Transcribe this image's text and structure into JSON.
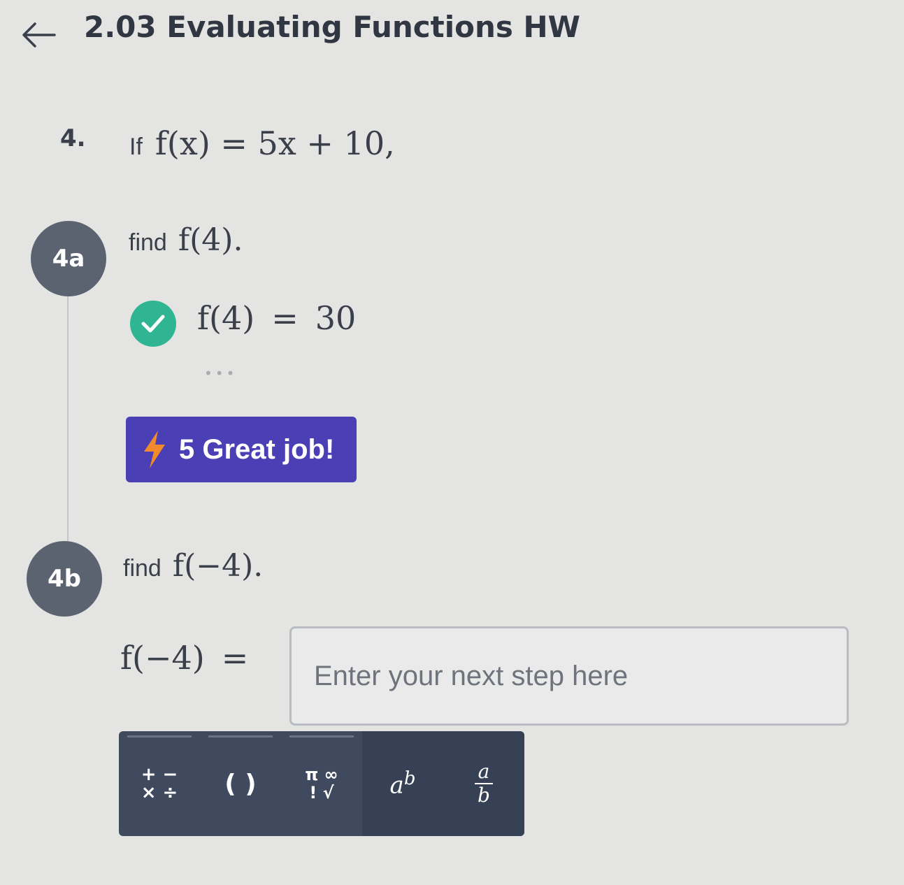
{
  "header": {
    "title": "2.03 Evaluating Functions HW"
  },
  "question": {
    "number": "4.",
    "prefix": "If",
    "expression": "f(x) = 5x + 10,"
  },
  "parts": [
    {
      "id": "4a",
      "prompt": "find",
      "expression": "f(4).",
      "answer_lhs": "f(4)",
      "answer_eq": "=",
      "answer_value": "30",
      "dots": "•••"
    },
    {
      "id": "4b",
      "prompt": "find",
      "expression": "f(−4).",
      "answer_lhs": "f(−4)",
      "answer_eq": "="
    }
  ],
  "badge": {
    "text": "5 Great job!",
    "color": "#4a3fb4"
  },
  "input": {
    "placeholder": "Enter your next step here"
  },
  "toolbar": {
    "ops_top": "+ −",
    "ops_bottom": "× ÷",
    "parens": "( )",
    "special_top": "π ∞",
    "special_bottom": "! √",
    "power_base": "a",
    "power_exp": "b",
    "frac_num": "a",
    "frac_den": "b"
  },
  "colors": {
    "check": "#2fb592",
    "circle": "#5b6270",
    "toolbar": "#3f4a5f"
  }
}
